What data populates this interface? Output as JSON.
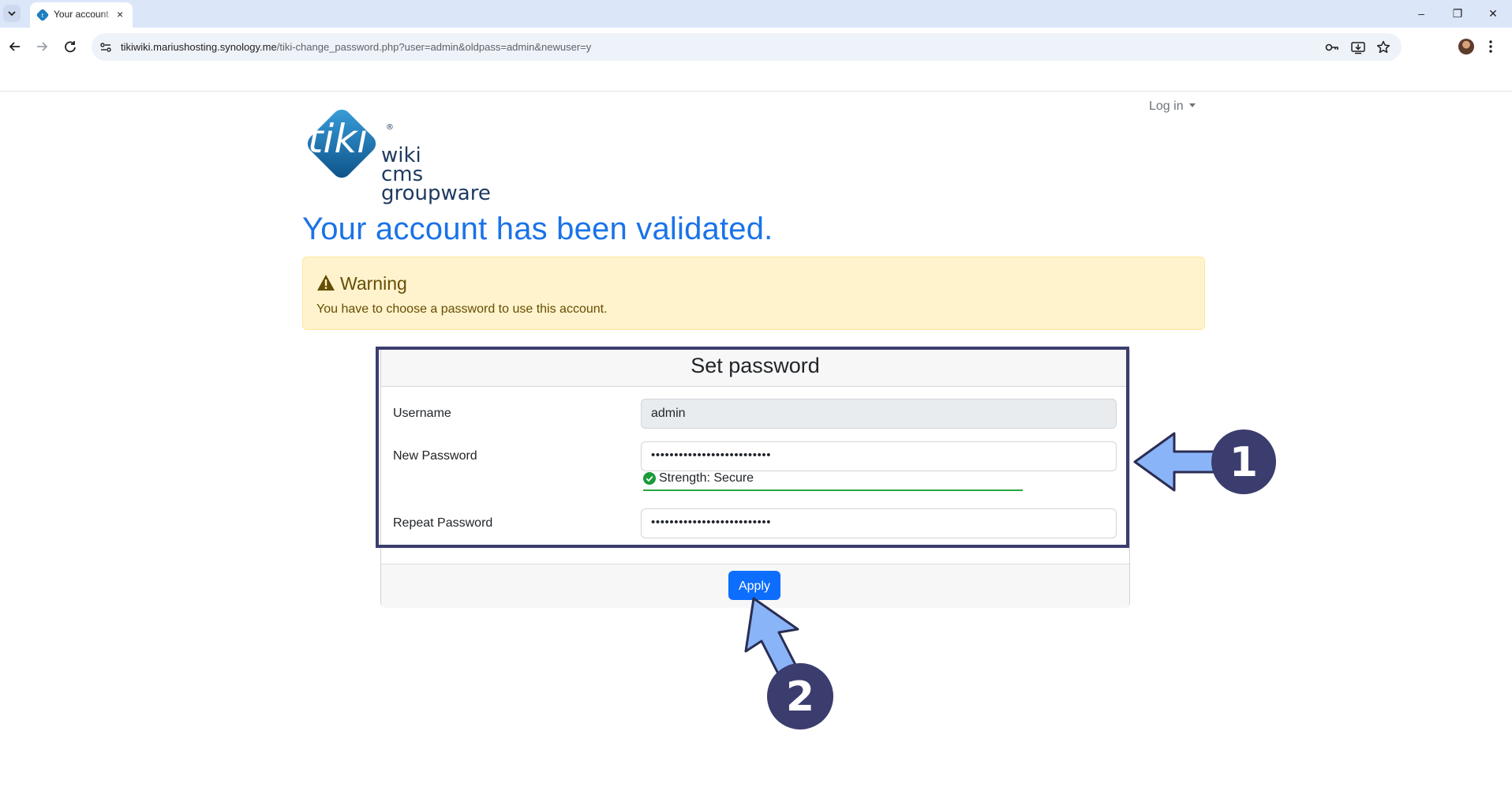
{
  "browser": {
    "tab_title": "Your account",
    "tab_close": "×",
    "url_host": "tikiwiki.mariushosting.synology.me",
    "url_path": "/tiki-change_password.php?user=admin&oldpass=admin&newuser=y",
    "window_buttons": {
      "minimize": "–",
      "restore": "❐",
      "close": "✕"
    }
  },
  "header": {
    "logo": {
      "mark": "tiki",
      "lines": [
        "wiki",
        "cms",
        "groupware"
      ]
    },
    "login_link": "Log in"
  },
  "page": {
    "title": "Your account has been validated."
  },
  "warning": {
    "title": "Warning",
    "text": "You have to choose a password to use this account."
  },
  "form": {
    "title": "Set password",
    "username_label": "Username",
    "username_value": "admin",
    "new_password_label": "New Password",
    "new_password_value": "••••••••••••••••••••••••••",
    "strength_label": "Strength: Secure",
    "repeat_password_label": "Repeat Password",
    "repeat_password_value": "••••••••••••••••••••••••••",
    "submit_label": "Apply"
  },
  "annotations": {
    "step1": "1",
    "step2": "2"
  },
  "colors": {
    "accent": "#0d6efd",
    "title": "#1a73e8",
    "warning_bg": "#fff3cd",
    "warning_text": "#664d03",
    "strength_ok": "#28a745",
    "annotation_fill": "#3b3d6e",
    "arrow_fill": "#8ab4f8"
  }
}
